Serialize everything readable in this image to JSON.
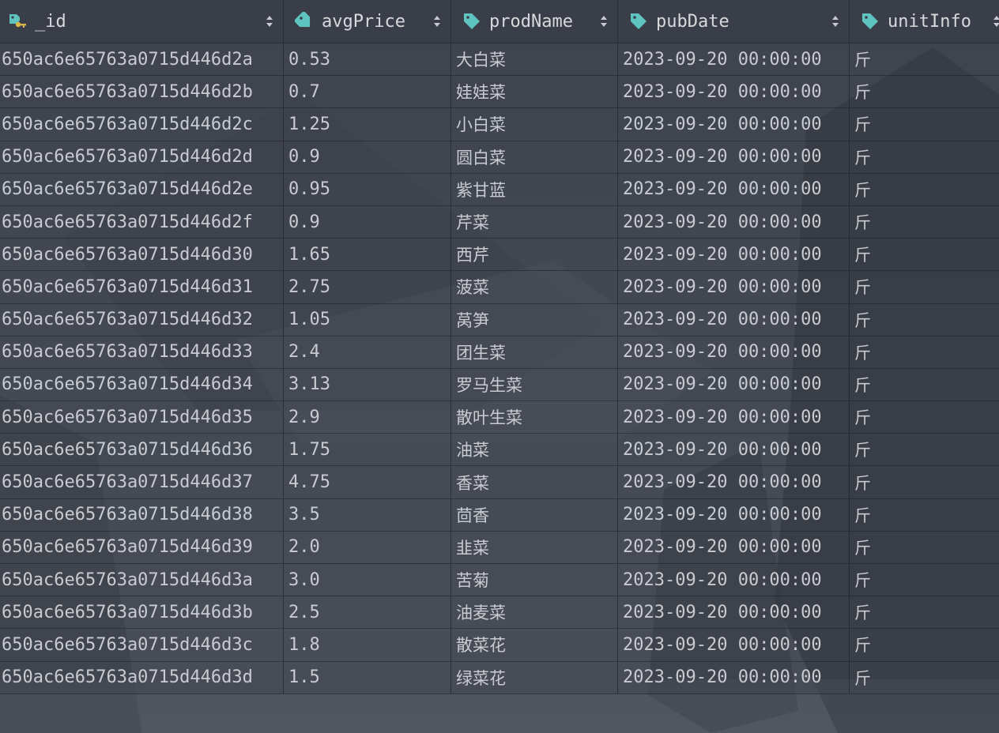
{
  "columns": [
    {
      "label": "_id",
      "icon": "key-icon"
    },
    {
      "label": "avgPrice",
      "icon": "tag-icon"
    },
    {
      "label": "prodName",
      "icon": "tag-icon"
    },
    {
      "label": "pubDate",
      "icon": "tag-icon"
    },
    {
      "label": "unitInfo",
      "icon": "tag-icon"
    }
  ],
  "rows": [
    {
      "id": "650ac6e65763a0715d446d2a",
      "avgPrice": "0.53",
      "prodName": "大白菜",
      "pubDate": "2023-09-20 00:00:00",
      "unitInfo": "斤"
    },
    {
      "id": "650ac6e65763a0715d446d2b",
      "avgPrice": "0.7",
      "prodName": "娃娃菜",
      "pubDate": "2023-09-20 00:00:00",
      "unitInfo": "斤"
    },
    {
      "id": "650ac6e65763a0715d446d2c",
      "avgPrice": "1.25",
      "prodName": "小白菜",
      "pubDate": "2023-09-20 00:00:00",
      "unitInfo": "斤"
    },
    {
      "id": "650ac6e65763a0715d446d2d",
      "avgPrice": "0.9",
      "prodName": "圆白菜",
      "pubDate": "2023-09-20 00:00:00",
      "unitInfo": "斤"
    },
    {
      "id": "650ac6e65763a0715d446d2e",
      "avgPrice": "0.95",
      "prodName": "紫甘蓝",
      "pubDate": "2023-09-20 00:00:00",
      "unitInfo": "斤"
    },
    {
      "id": "650ac6e65763a0715d446d2f",
      "avgPrice": "0.9",
      "prodName": "芹菜",
      "pubDate": "2023-09-20 00:00:00",
      "unitInfo": "斤"
    },
    {
      "id": "650ac6e65763a0715d446d30",
      "avgPrice": "1.65",
      "prodName": "西芹",
      "pubDate": "2023-09-20 00:00:00",
      "unitInfo": "斤"
    },
    {
      "id": "650ac6e65763a0715d446d31",
      "avgPrice": "2.75",
      "prodName": "菠菜",
      "pubDate": "2023-09-20 00:00:00",
      "unitInfo": "斤"
    },
    {
      "id": "650ac6e65763a0715d446d32",
      "avgPrice": "1.05",
      "prodName": "莴笋",
      "pubDate": "2023-09-20 00:00:00",
      "unitInfo": "斤"
    },
    {
      "id": "650ac6e65763a0715d446d33",
      "avgPrice": "2.4",
      "prodName": "团生菜",
      "pubDate": "2023-09-20 00:00:00",
      "unitInfo": "斤"
    },
    {
      "id": "650ac6e65763a0715d446d34",
      "avgPrice": "3.13",
      "prodName": "罗马生菜",
      "pubDate": "2023-09-20 00:00:00",
      "unitInfo": "斤"
    },
    {
      "id": "650ac6e65763a0715d446d35",
      "avgPrice": "2.9",
      "prodName": "散叶生菜",
      "pubDate": "2023-09-20 00:00:00",
      "unitInfo": "斤"
    },
    {
      "id": "650ac6e65763a0715d446d36",
      "avgPrice": "1.75",
      "prodName": "油菜",
      "pubDate": "2023-09-20 00:00:00",
      "unitInfo": "斤"
    },
    {
      "id": "650ac6e65763a0715d446d37",
      "avgPrice": "4.75",
      "prodName": "香菜",
      "pubDate": "2023-09-20 00:00:00",
      "unitInfo": "斤"
    },
    {
      "id": "650ac6e65763a0715d446d38",
      "avgPrice": "3.5",
      "prodName": "茴香",
      "pubDate": "2023-09-20 00:00:00",
      "unitInfo": "斤"
    },
    {
      "id": "650ac6e65763a0715d446d39",
      "avgPrice": "2.0",
      "prodName": "韭菜",
      "pubDate": "2023-09-20 00:00:00",
      "unitInfo": "斤"
    },
    {
      "id": "650ac6e65763a0715d446d3a",
      "avgPrice": "3.0",
      "prodName": "苦菊",
      "pubDate": "2023-09-20 00:00:00",
      "unitInfo": "斤"
    },
    {
      "id": "650ac6e65763a0715d446d3b",
      "avgPrice": "2.5",
      "prodName": "油麦菜",
      "pubDate": "2023-09-20 00:00:00",
      "unitInfo": "斤"
    },
    {
      "id": "650ac6e65763a0715d446d3c",
      "avgPrice": "1.8",
      "prodName": "散菜花",
      "pubDate": "2023-09-20 00:00:00",
      "unitInfo": "斤"
    },
    {
      "id": "650ac6e65763a0715d446d3d",
      "avgPrice": "1.5",
      "prodName": "绿菜花",
      "pubDate": "2023-09-20 00:00:00",
      "unitInfo": "斤"
    }
  ],
  "colors": {
    "tag_icon": "#5fc4c0",
    "key_icon": "#d8b64a"
  }
}
